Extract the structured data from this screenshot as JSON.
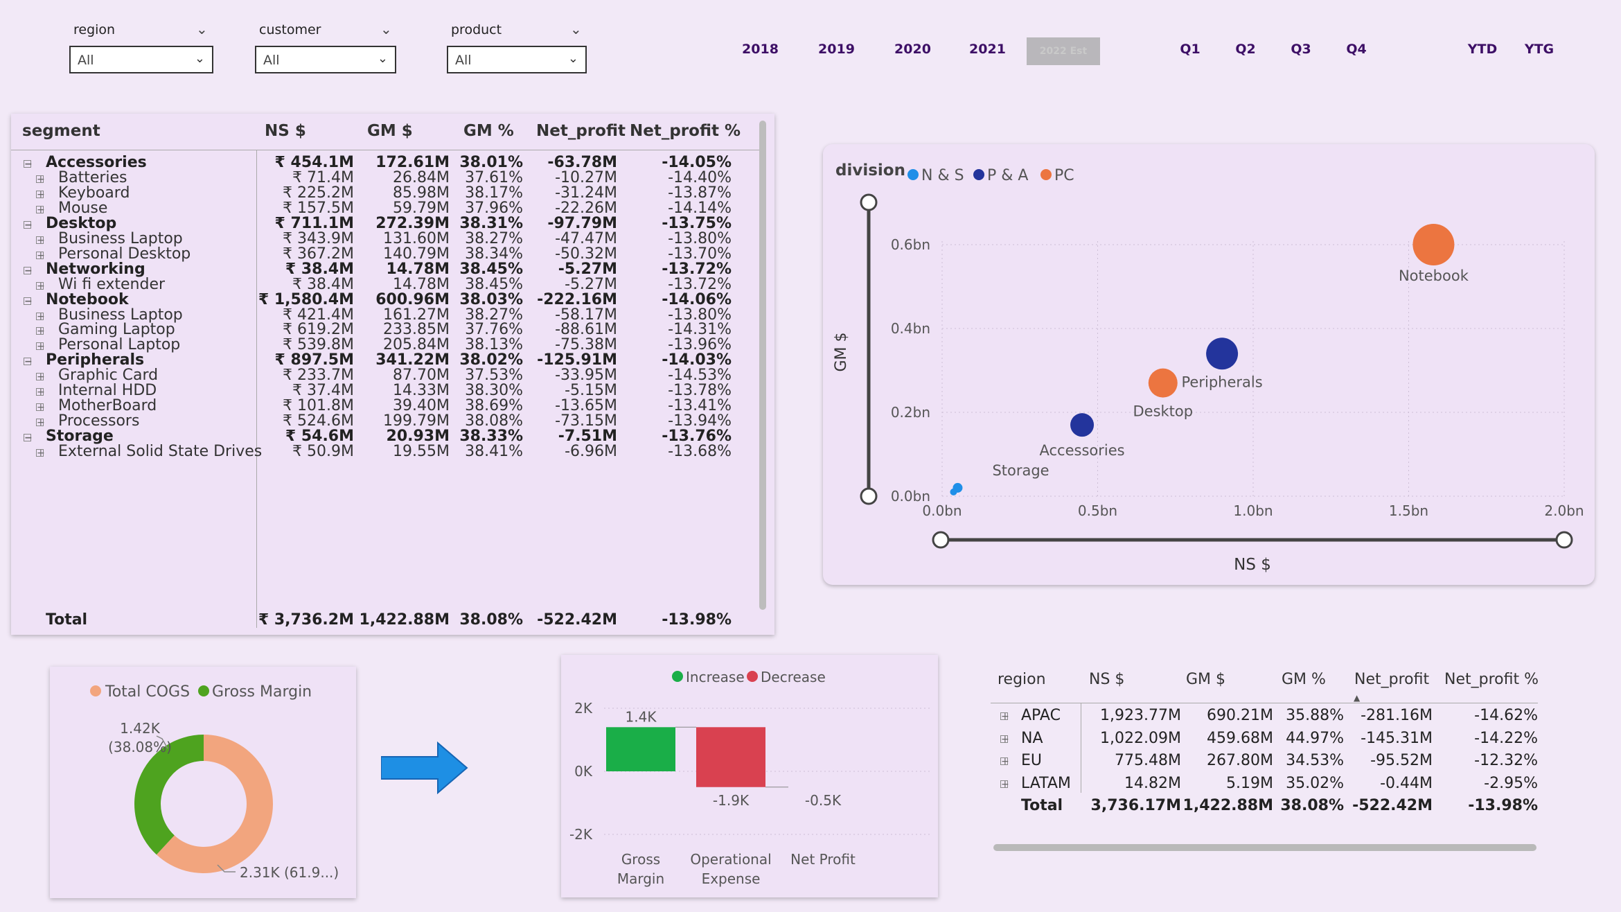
{
  "slicers": [
    {
      "label": "region",
      "value": "All"
    },
    {
      "label": "customer",
      "value": "All"
    },
    {
      "label": "product",
      "value": "All"
    }
  ],
  "years": [
    "2018",
    "2019",
    "2020",
    "2021",
    "2022 Est"
  ],
  "quarters": [
    "Q1",
    "Q2",
    "Q3",
    "Q4"
  ],
  "periods": [
    "YTD",
    "YTG"
  ],
  "matrix": {
    "headers": [
      "segment",
      "NS $",
      "GM $",
      "GM %",
      "Net_profit",
      "Net_profit %"
    ],
    "rows": [
      {
        "level": 0,
        "name": "Accessories",
        "ns": "₹ 454.1M",
        "gm": "172.61M",
        "gmp": "38.01%",
        "np": "-63.78M",
        "npp": "-14.05%"
      },
      {
        "level": 1,
        "name": "Batteries",
        "ns": "₹ 71.4M",
        "gm": "26.84M",
        "gmp": "37.61%",
        "np": "-10.27M",
        "npp": "-14.40%"
      },
      {
        "level": 1,
        "name": "Keyboard",
        "ns": "₹ 225.2M",
        "gm": "85.98M",
        "gmp": "38.17%",
        "np": "-31.24M",
        "npp": "-13.87%"
      },
      {
        "level": 1,
        "name": "Mouse",
        "ns": "₹ 157.5M",
        "gm": "59.79M",
        "gmp": "37.96%",
        "np": "-22.26M",
        "npp": "-14.14%"
      },
      {
        "level": 0,
        "name": "Desktop",
        "ns": "₹ 711.1M",
        "gm": "272.39M",
        "gmp": "38.31%",
        "np": "-97.79M",
        "npp": "-13.75%"
      },
      {
        "level": 1,
        "name": "Business Laptop",
        "ns": "₹ 343.9M",
        "gm": "131.60M",
        "gmp": "38.27%",
        "np": "-47.47M",
        "npp": "-13.80%"
      },
      {
        "level": 1,
        "name": "Personal Desktop",
        "ns": "₹ 367.2M",
        "gm": "140.79M",
        "gmp": "38.34%",
        "np": "-50.32M",
        "npp": "-13.70%"
      },
      {
        "level": 0,
        "name": "Networking",
        "ns": "₹ 38.4M",
        "gm": "14.78M",
        "gmp": "38.45%",
        "np": "-5.27M",
        "npp": "-13.72%"
      },
      {
        "level": 1,
        "name": "Wi fi extender",
        "ns": "₹ 38.4M",
        "gm": "14.78M",
        "gmp": "38.45%",
        "np": "-5.27M",
        "npp": "-13.72%"
      },
      {
        "level": 0,
        "name": "Notebook",
        "ns": "₹ 1,580.4M",
        "gm": "600.96M",
        "gmp": "38.03%",
        "np": "-222.16M",
        "npp": "-14.06%"
      },
      {
        "level": 1,
        "name": "Business Laptop",
        "ns": "₹ 421.4M",
        "gm": "161.27M",
        "gmp": "38.27%",
        "np": "-58.17M",
        "npp": "-13.80%"
      },
      {
        "level": 1,
        "name": "Gaming Laptop",
        "ns": "₹ 619.2M",
        "gm": "233.85M",
        "gmp": "37.76%",
        "np": "-88.61M",
        "npp": "-14.31%"
      },
      {
        "level": 1,
        "name": "Personal Laptop",
        "ns": "₹ 539.8M",
        "gm": "205.84M",
        "gmp": "38.13%",
        "np": "-75.38M",
        "npp": "-13.96%"
      },
      {
        "level": 0,
        "name": "Peripherals",
        "ns": "₹ 897.5M",
        "gm": "341.22M",
        "gmp": "38.02%",
        "np": "-125.91M",
        "npp": "-14.03%"
      },
      {
        "level": 1,
        "name": "Graphic Card",
        "ns": "₹ 233.7M",
        "gm": "87.70M",
        "gmp": "37.53%",
        "np": "-33.95M",
        "npp": "-14.53%"
      },
      {
        "level": 1,
        "name": "Internal HDD",
        "ns": "₹ 37.4M",
        "gm": "14.33M",
        "gmp": "38.30%",
        "np": "-5.15M",
        "npp": "-13.78%"
      },
      {
        "level": 1,
        "name": "MotherBoard",
        "ns": "₹ 101.8M",
        "gm": "39.40M",
        "gmp": "38.69%",
        "np": "-13.65M",
        "npp": "-13.41%"
      },
      {
        "level": 1,
        "name": "Processors",
        "ns": "₹ 524.6M",
        "gm": "199.79M",
        "gmp": "38.08%",
        "np": "-73.15M",
        "npp": "-13.94%"
      },
      {
        "level": 0,
        "name": "Storage",
        "ns": "₹ 54.6M",
        "gm": "20.93M",
        "gmp": "38.33%",
        "np": "-7.51M",
        "npp": "-13.76%"
      },
      {
        "level": 1,
        "name": "External Solid State Drives",
        "ns": "₹ 50.9M",
        "gm": "19.55M",
        "gmp": "38.41%",
        "np": "-6.96M",
        "npp": "-13.68%"
      }
    ],
    "total": {
      "name": "Total",
      "ns": "₹ 3,736.2M",
      "gm": "1,422.88M",
      "gmp": "38.08%",
      "np": "-522.42M",
      "npp": "-13.98%"
    }
  },
  "scatter": {
    "legend_title": "division",
    "legend": [
      {
        "name": "N & S",
        "color": "#1f8fe8"
      },
      {
        "name": "P & A",
        "color": "#23349c"
      },
      {
        "name": "PC",
        "color": "#ec7540"
      }
    ],
    "xlabel": "NS $",
    "ylabel": "GM $",
    "xticks": [
      "0.0bn",
      "0.5bn",
      "1.0bn",
      "1.5bn",
      "2.0bn"
    ],
    "yticks": [
      "0.0bn",
      "0.2bn",
      "0.4bn",
      "0.6bn"
    ]
  },
  "donut": {
    "legend": [
      {
        "name": "Total COGS",
        "color": "#f2a57e"
      },
      {
        "name": "Gross Margin",
        "color": "#4ea31f"
      }
    ],
    "label_gm": "1.42K",
    "label_gm2": "(38.08%)",
    "label_cogs": "2.31K (61.9...)"
  },
  "waterfall": {
    "legend": [
      {
        "name": "Increase",
        "color": "#1aae48"
      },
      {
        "name": "Decrease",
        "color": "#d94150"
      }
    ],
    "yticks": [
      "2K",
      "0K",
      "-2K"
    ],
    "bar_labels": [
      "1.4K",
      "-1.9K",
      "-0.5K"
    ],
    "categories": [
      "Gross Margin",
      "Operational Expense",
      "Net Profit"
    ]
  },
  "region_table": {
    "headers": [
      "region",
      "NS $",
      "GM $",
      "GM %",
      "Net_profit",
      "Net_profit %"
    ],
    "rows": [
      {
        "name": "APAC",
        "ns": "1,923.77M",
        "gm": "690.21M",
        "gmp": "35.88%",
        "np": "-281.16M",
        "npp": "-14.62%"
      },
      {
        "name": "NA",
        "ns": "1,022.09M",
        "gm": "459.68M",
        "gmp": "44.97%",
        "np": "-145.31M",
        "npp": "-14.22%"
      },
      {
        "name": "EU",
        "ns": "775.48M",
        "gm": "267.80M",
        "gmp": "34.53%",
        "np": "-95.52M",
        "npp": "-12.32%"
      },
      {
        "name": "LATAM",
        "ns": "14.82M",
        "gm": "5.19M",
        "gmp": "35.02%",
        "np": "-0.44M",
        "npp": "-2.95%"
      }
    ],
    "total": {
      "name": "Total",
      "ns": "3,736.17M",
      "gm": "1,422.88M",
      "gmp": "38.08%",
      "np": "-522.42M",
      "npp": "-13.98%"
    }
  },
  "chart_data": [
    {
      "type": "scatter",
      "xlabel": "NS $",
      "ylabel": "GM $",
      "xlim": [
        0,
        2.0
      ],
      "ylim": [
        0,
        0.6
      ],
      "legend_title": "division",
      "series": [
        {
          "name": "N & S",
          "points": [
            {
              "label": "Storage",
              "x": 0.05,
              "y": 0.02
            }
          ]
        },
        {
          "name": "P & A",
          "points": [
            {
              "label": "Accessories",
              "x": 0.45,
              "y": 0.17
            },
            {
              "label": "Peripherals",
              "x": 0.9,
              "y": 0.34
            }
          ]
        },
        {
          "name": "PC",
          "points": [
            {
              "label": "Desktop",
              "x": 0.71,
              "y": 0.27
            },
            {
              "label": "Notebook",
              "x": 1.58,
              "y": 0.6
            }
          ]
        }
      ]
    },
    {
      "type": "pie",
      "categories": [
        "Total COGS",
        "Gross Margin"
      ],
      "values": [
        2313.3,
        1422.88
      ],
      "labels": [
        "2.31K (61.9...)",
        "1.42K (38.08%)"
      ]
    },
    {
      "type": "bar",
      "subtype": "waterfall",
      "categories": [
        "Gross Margin",
        "Operational Expense",
        "Net Profit"
      ],
      "values": [
        1.4,
        -1.9,
        -0.5
      ],
      "ylim": [
        -2,
        2
      ],
      "legend": [
        "Increase",
        "Decrease"
      ]
    }
  ]
}
